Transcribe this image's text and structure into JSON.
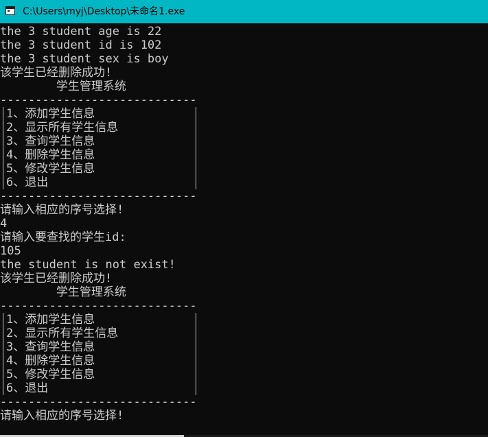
{
  "window": {
    "title": "C:\\Users\\myj\\Desktop\\未命名1.exe",
    "titlebar_color": "#00b7c3",
    "icon": "console-window-icon"
  },
  "console": {
    "text_color": "#cccccc",
    "background": "#0c0c0c",
    "block1": [
      "the 3 student age is 22",
      "the 3 student id is 102",
      "the 3 student sex is boy",
      "该学生已经删除成功!",
      "        学生管理系统",
      "----------------------------"
    ],
    "menu": [
      "1、添加学生信息",
      "2、显示所有学生信息",
      "3、查询学生信息",
      "4、删除学生信息",
      "5、修改学生信息",
      "6、退出"
    ],
    "separator": "----------------------------",
    "block2": [
      "请输入相应的序号选择!",
      "4",
      "请输入要查找的学生id:",
      "105",
      "the student is not exist!",
      "该学生已经删除成功!",
      "        学生管理系统",
      "----------------------------"
    ],
    "final_prompt": "请输入相应的序号选择!"
  }
}
